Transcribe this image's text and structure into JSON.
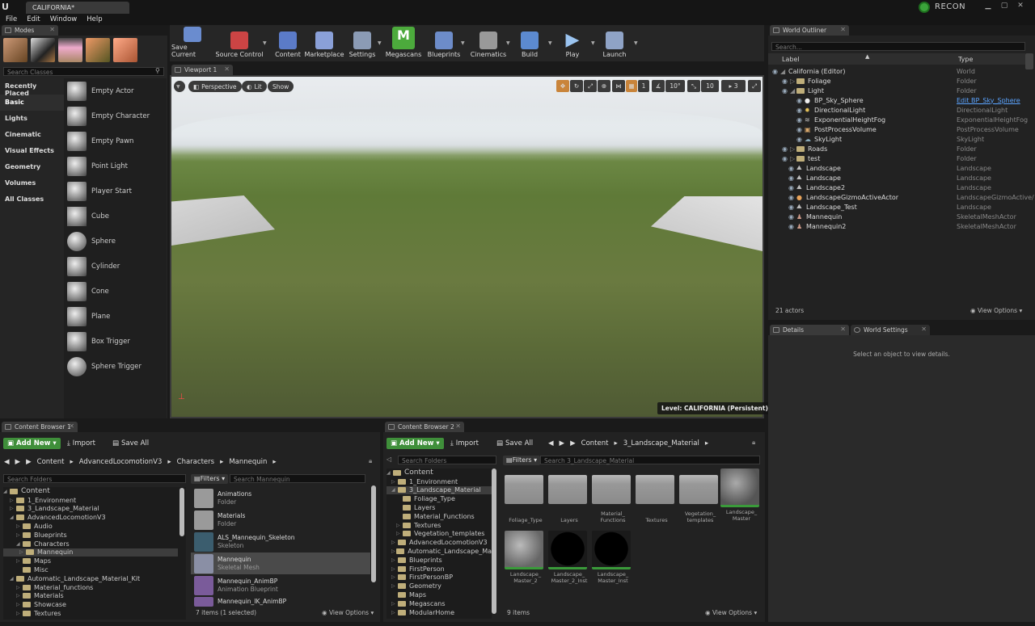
{
  "app": {
    "doc_tab": "CALIFORNIA*",
    "project": "RECON"
  },
  "menu": [
    "File",
    "Edit",
    "Window",
    "Help"
  ],
  "modes": {
    "tab": "Modes",
    "search_placeholder": "Search Classes",
    "categories": [
      "Recently Placed",
      "Basic",
      "Lights",
      "Cinematic",
      "Visual Effects",
      "Geometry",
      "Volumes",
      "All Classes"
    ],
    "active_category": "Basic",
    "items": [
      "Empty Actor",
      "Empty Character",
      "Empty Pawn",
      "Point Light",
      "Player Start",
      "Cube",
      "Sphere",
      "Cylinder",
      "Cone",
      "Plane",
      "Box Trigger",
      "Sphere Trigger"
    ]
  },
  "toolbar": [
    "Save Current",
    "Source Control",
    "Content",
    "Marketplace",
    "Settings",
    "Megascans",
    "Blueprints",
    "Cinematics",
    "Build",
    "Play",
    "Launch"
  ],
  "viewport": {
    "tab": "Viewport 1",
    "perspective": "Perspective",
    "lit": "Lit",
    "show": "Show",
    "grid_snap": "1",
    "rotation_snap": "10°",
    "scale_snap": "10",
    "camera_speed": "3",
    "level": "Level:  CALIFORNIA (Persistent)"
  },
  "outliner": {
    "tab": "World Outliner",
    "search_placeholder": "Search...",
    "col_label": "Label",
    "col_type": "Type",
    "rows": [
      {
        "label": "California (Editor)",
        "type": "World"
      },
      {
        "label": "Foliage",
        "type": "Folder"
      },
      {
        "label": "Light",
        "type": "Folder"
      },
      {
        "label": "BP_Sky_Sphere",
        "type": "Edit BP_Sky_Sphere"
      },
      {
        "label": "DirectionalLight",
        "type": "DirectionalLight"
      },
      {
        "label": "ExponentialHeightFog",
        "type": "ExponentialHeightFog"
      },
      {
        "label": "PostProcessVolume",
        "type": "PostProcessVolume"
      },
      {
        "label": "SkyLight",
        "type": "SkyLight"
      },
      {
        "label": "Roads",
        "type": "Folder"
      },
      {
        "label": "test",
        "type": "Folder"
      },
      {
        "label": "Landscape",
        "type": "Landscape"
      },
      {
        "label": "Landscape",
        "type": "Landscape"
      },
      {
        "label": "Landscape2",
        "type": "Landscape"
      },
      {
        "label": "LandscapeGizmoActiveActor",
        "type": "LandscapeGizmoActive/"
      },
      {
        "label": "Landscape_Test",
        "type": "Landscape"
      },
      {
        "label": "Mannequin",
        "type": "SkeletalMeshActor"
      },
      {
        "label": "Mannequin2",
        "type": "SkeletalMeshActor"
      }
    ],
    "actor_count": "21 actors",
    "view_options": "View Options"
  },
  "details": {
    "tab": "Details",
    "tab2": "World Settings",
    "empty": "Select an object to view details."
  },
  "cb1": {
    "tab": "Content Browser 1",
    "add_new": "Add New",
    "import": "Import",
    "save_all": "Save All",
    "path": [
      "Content",
      "AdvancedLocomotionV3",
      "Characters",
      "Mannequin"
    ],
    "search_folders": "Search Folders",
    "filters": "Filters",
    "search_assets": "Search Mannequin",
    "tree": [
      "Content",
      "1_Environment",
      "3_Landscape_Material",
      "AdvancedLocomotionV3",
      "Audio",
      "Blueprints",
      "Characters",
      "Mannequin",
      "Maps",
      "Misc",
      "Automatic_Landscape_Material_Kit",
      "Material_functions",
      "Materials",
      "Showcase",
      "Textures"
    ],
    "assets": [
      {
        "name": "Animations",
        "type": "Folder"
      },
      {
        "name": "Materials",
        "type": "Folder"
      },
      {
        "name": "ALS_Mannequin_Skeleton",
        "type": "Skeleton"
      },
      {
        "name": "Mannequin",
        "type": "Skeletal Mesh"
      },
      {
        "name": "Mannequin_AnimBP",
        "type": "Animation Blueprint"
      },
      {
        "name": "Mannequin_IK_AnimBP",
        "type": ""
      }
    ],
    "status": "7 items (1 selected)",
    "view_options": "View Options"
  },
  "cb2": {
    "tab": "Content Browser 2",
    "add_new": "Add New",
    "import": "Import",
    "save_all": "Save All",
    "path": [
      "Content",
      "3_Landscape_Material"
    ],
    "search_folders": "Search Folders",
    "filters": "Filters",
    "search_assets": "Search 3_Landscape_Material",
    "tree": [
      "Content",
      "1_Environment",
      "3_Landscape_Material",
      "Foliage_Type",
      "Layers",
      "Material_Functions",
      "Textures",
      "Vegetation_templates",
      "AdvancedLocomotionV3",
      "Automatic_Landscape_Ma",
      "Blueprints",
      "FirstPerson",
      "FirstPersonBP",
      "Geometry",
      "Maps",
      "Megascans",
      "ModularHome"
    ],
    "assets": [
      {
        "name": "Foliage_Type"
      },
      {
        "name": "Layers"
      },
      {
        "name": "Material_ Functions"
      },
      {
        "name": "Textures"
      },
      {
        "name": "Vegetation_ templates"
      },
      {
        "name": "Landscape_ Master"
      },
      {
        "name": "Landscape_ Master_2"
      },
      {
        "name": "Landscape_ Master_2_Inst"
      },
      {
        "name": "Landscape_ Master_Inst"
      }
    ],
    "status": "9 items",
    "view_options": "View Options"
  }
}
